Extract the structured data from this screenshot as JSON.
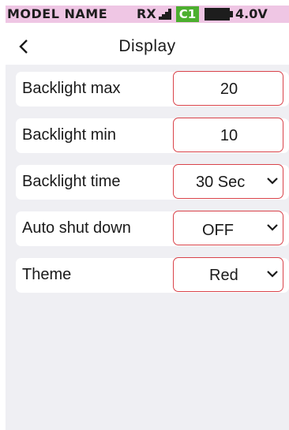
{
  "status_bar": {
    "model_name": "MODEL NAME",
    "rx_label": "RX",
    "signal_icon": "signal-bars-icon",
    "channel_badge": "C1",
    "channel_badge_color": "#4caf2f",
    "battery_icon": "battery-icon",
    "voltage": "4.0V",
    "background_color": "#efc6e4"
  },
  "header": {
    "back_icon": "chevron-left-icon",
    "title": "Display"
  },
  "settings": [
    {
      "label": "Backlight max",
      "value": "20"
    },
    {
      "label": "Backlight min",
      "value": "10"
    },
    {
      "label": "Backlight time",
      "value": "30 Sec"
    },
    {
      "label": "Auto shut down",
      "value": "OFF"
    },
    {
      "label": "Theme",
      "value": "Red"
    }
  ],
  "accent_color": "#d9434a"
}
